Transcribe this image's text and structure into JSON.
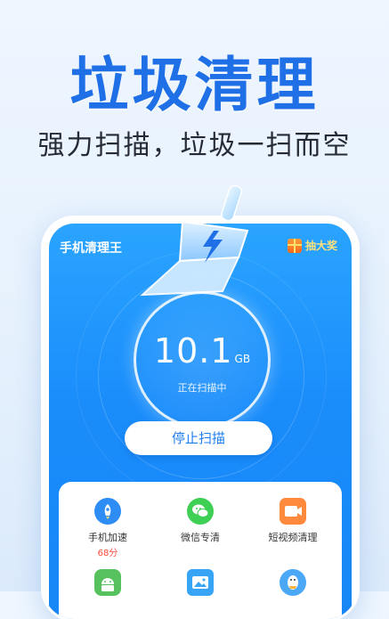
{
  "headline": "垃圾清理",
  "subline": "强力扫描，垃圾一扫而空",
  "app": {
    "title": "手机清理王",
    "prize_label": "抽大奖"
  },
  "scan": {
    "size_value": "10.1",
    "size_unit": "GB",
    "status": "正在扫描中",
    "stop_label": "停止扫描"
  },
  "tools": [
    {
      "label": "手机加速",
      "badge": "68分",
      "icon": "rocket-icon"
    },
    {
      "label": "微信专清",
      "icon": "wechat-icon"
    },
    {
      "label": "短视频清理",
      "icon": "video-icon"
    },
    {
      "icon": "android-icon"
    },
    {
      "icon": "image-icon"
    },
    {
      "icon": "qq-penguin-icon"
    }
  ],
  "colors": {
    "brand_blue": "#1f6fe6",
    "screen_blue": "#1a8dfb",
    "badge_red": "#ff4a3d",
    "prize_yellow": "#ffe27a"
  }
}
